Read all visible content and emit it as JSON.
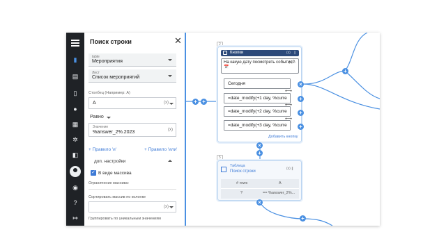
{
  "panel": {
    "title": "Поиск строки",
    "table_label": "table",
    "table_value": "Мероприятия",
    "sheet_label": "Лист",
    "sheet_value": "Список мероприятий",
    "column_placeholder": "Столбец (Например: А)",
    "column_value": "A",
    "operator_value": "Равно",
    "value_label": "Значение",
    "value_value": "%answer_2%.2023",
    "rule_and": "+ Правило 'и'",
    "rule_or": "+ Правило 'или'",
    "extra_settings": "доп. настройки",
    "as_array_label": "В виде массива",
    "array_limit_label": "Ограничение массива:",
    "sort_label": "Сортировать массив по колонке",
    "group_label": "Группировать по уникальным значениям"
  },
  "canvas": {
    "node2": {
      "number": "2",
      "header": "Кнопки",
      "message": "На какую дату посмотреть события? 📅",
      "buttons": [
        "Сегодня",
        "=date_modify(+1 day, %curre",
        "=date_modify(+2 day, %curre",
        "=date_modify(+3 day, %curre"
      ],
      "add_button": "Добавить кнопку"
    },
    "node5": {
      "number": "5",
      "header_line1": "Таблица",
      "header_line2": "Поиск строки",
      "col1": "# rows",
      "col2": "A",
      "cell1": "?",
      "cell2": "== %answer_2%..."
    }
  },
  "icons": [
    "menu-icon",
    "file-icon",
    "chart-icon",
    "document-icon",
    "chat-icon",
    "table-icon",
    "settings-icon",
    "user-icon",
    "dashboard-icon",
    "help-icon",
    "logout-icon"
  ],
  "colors": {
    "accent": "#4a90e2",
    "nav_bg": "#1f2226",
    "header_bg": "#2d4a7a"
  }
}
